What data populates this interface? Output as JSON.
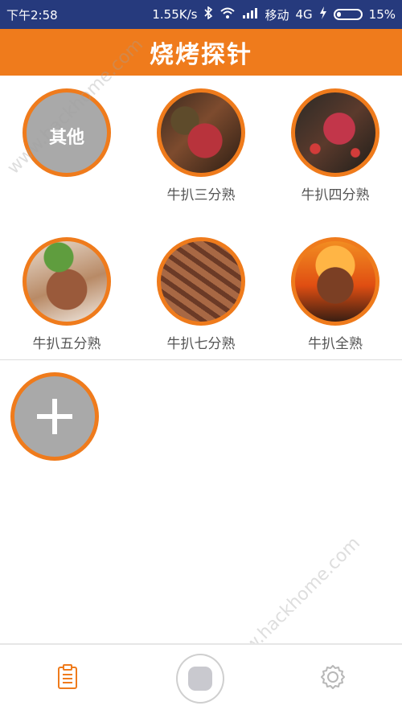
{
  "status_bar": {
    "time": "下午2:58",
    "speed": "1.55K/s",
    "carrier": "移动",
    "network": "4G",
    "battery": "15%"
  },
  "title": "烧烤探针",
  "items": [
    {
      "label": "其他",
      "overlay_text": "其他",
      "type": "gray"
    },
    {
      "label": "牛扒三分熟",
      "type": "steak-1"
    },
    {
      "label": "牛扒四分熟",
      "type": "steak-2"
    },
    {
      "label": "牛扒五分熟",
      "type": "steak-3"
    },
    {
      "label": "牛扒七分熟",
      "type": "steak-4"
    },
    {
      "label": "牛扒全熟",
      "type": "steak-5"
    }
  ],
  "add_button": {
    "icon": "plus-icon"
  },
  "bottom_nav": {
    "left_icon": "notes-icon",
    "center_icon": "record-button",
    "right_icon": "gear-icon"
  },
  "watermark": "www.hackhome.com",
  "colors": {
    "status_bar": "#263a7d",
    "accent": "#ef7b1c",
    "gray_circle": "#a9a9a9"
  }
}
